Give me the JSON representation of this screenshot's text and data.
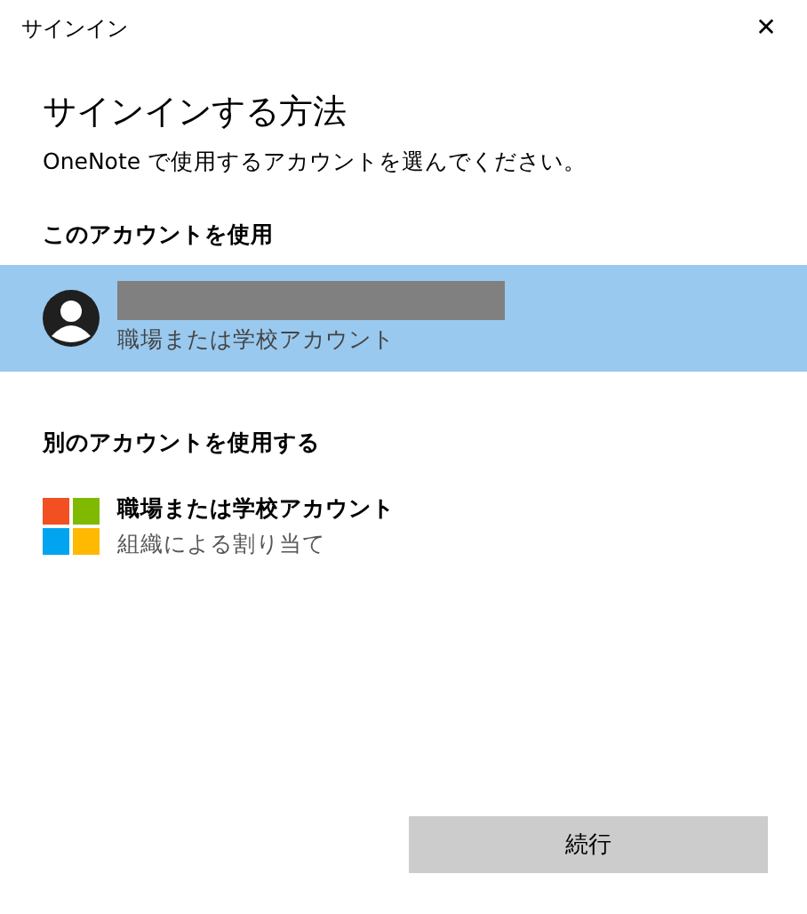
{
  "window": {
    "title": "サインイン",
    "close": "✕"
  },
  "heading": "サインインする方法",
  "subtitle": "OneNote で使用するアカウントを選んでください。",
  "sections": [
    {
      "title": "このアカウントを使用",
      "items": [
        {
          "kind": "account",
          "redacted": true,
          "subtitle": "職場または学校アカウント",
          "selected": true
        }
      ]
    },
    {
      "title": "別のアカウントを使用する",
      "items": [
        {
          "kind": "microsoft",
          "name": "職場または学校アカウント",
          "subtitle": "組織による割り当て",
          "selected": false
        }
      ]
    }
  ],
  "button": "続行"
}
